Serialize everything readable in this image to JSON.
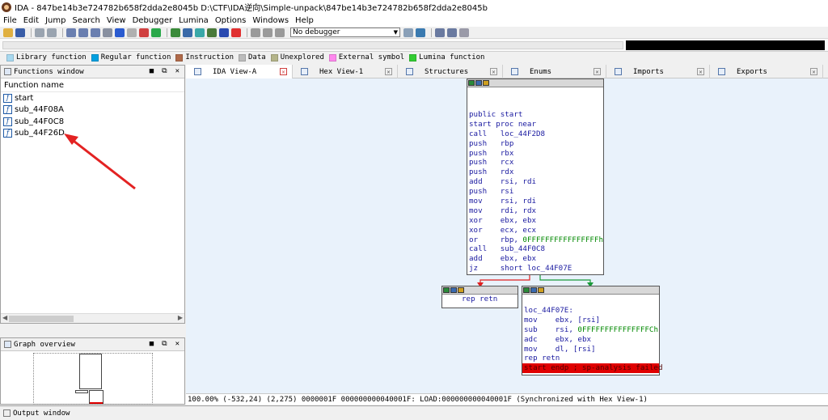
{
  "window": {
    "title": "IDA - 847be14b3e724782b658f2dda2e8045b D:\\CTF\\IDA逆向\\Simple-unpack\\847be14b3e724782b658f2dda2e8045b"
  },
  "menu": [
    {
      "label": "File",
      "key": "file"
    },
    {
      "label": "Edit",
      "key": "edit"
    },
    {
      "label": "Jump",
      "key": "jump"
    },
    {
      "label": "Search",
      "key": "search"
    },
    {
      "label": "View",
      "key": "view"
    },
    {
      "label": "Debugger",
      "key": "debugger"
    },
    {
      "label": "Lumina",
      "key": "lumina"
    },
    {
      "label": "Options",
      "key": "options"
    },
    {
      "label": "Windows",
      "key": "windows"
    },
    {
      "label": "Help",
      "key": "help"
    }
  ],
  "toolbar": {
    "debugger_select": "No debugger"
  },
  "legend": [
    {
      "label": "Library function",
      "color": "#a8d9f0"
    },
    {
      "label": "Regular function",
      "color": "#00a0e0"
    },
    {
      "label": "Instruction",
      "color": "#b06a4a"
    },
    {
      "label": "Data",
      "color": "#bcbcbc"
    },
    {
      "label": "Unexplored",
      "color": "#b4b489"
    },
    {
      "label": "External symbol",
      "color": "#ff88ee"
    },
    {
      "label": "Lumina function",
      "color": "#33cc33"
    }
  ],
  "functions_window": {
    "title": "Functions window",
    "column": "Function name",
    "items": [
      "start",
      "sub_44F08A",
      "sub_44F0C8",
      "sub_44F26D"
    ]
  },
  "graph_overview": {
    "title": "Graph overview"
  },
  "tabs": [
    {
      "label": "IDA View-A",
      "active": true
    },
    {
      "label": "Hex View-1",
      "active": false
    },
    {
      "label": "Structures",
      "active": false
    },
    {
      "label": "Enums",
      "active": false
    },
    {
      "label": "Imports",
      "active": false
    },
    {
      "label": "Exports",
      "active": false
    }
  ],
  "graph": {
    "node_start": [
      {
        "m": "public start",
        "o": ""
      },
      {
        "m": "start proc near",
        "o": ""
      },
      {
        "m": "call",
        "o": "loc_44F2D8"
      },
      {
        "m": "push",
        "o": "rbp"
      },
      {
        "m": "push",
        "o": "rbx"
      },
      {
        "m": "push",
        "o": "rcx"
      },
      {
        "m": "push",
        "o": "rdx"
      },
      {
        "m": "add",
        "o": "rsi, rdi"
      },
      {
        "m": "push",
        "o": "rsi"
      },
      {
        "m": "mov",
        "o": "rsi, rdi"
      },
      {
        "m": "mov",
        "o": "rdi, rdx"
      },
      {
        "m": "xor",
        "o": "ebx, ebx"
      },
      {
        "m": "xor",
        "o": "ecx, ecx"
      },
      {
        "m": "or",
        "o": "rbp, ",
        "h": "0FFFFFFFFFFFFFFFFh"
      },
      {
        "m": "call",
        "o": "sub_44F0C8"
      },
      {
        "m": "add",
        "o": "ebx, ebx"
      },
      {
        "m": "jz",
        "o": "short loc_44F07E"
      }
    ],
    "node_retn": [
      {
        "m": "rep retn",
        "o": ""
      }
    ],
    "node_loc": [
      {
        "m": "loc_44F07E:",
        "o": ""
      },
      {
        "m": "mov",
        "o": "ebx, [rsi]"
      },
      {
        "m": "sub",
        "o": "rsi, ",
        "h": "0FFFFFFFFFFFFFFFCh"
      },
      {
        "m": "adc",
        "o": "ebx, ebx"
      },
      {
        "m": "mov",
        "o": "dl, [rsi]"
      },
      {
        "m": "rep retn",
        "o": ""
      },
      {
        "m": "start endp ; sp-analysis failed",
        "o": "",
        "hl": true
      }
    ]
  },
  "status": {
    "line": "100.00% (-532,24) (2,275) 0000001F 000000000040001F: LOAD:000000000040001F (Synchronized with Hex View-1)"
  },
  "output_window": {
    "title": "Output window"
  }
}
